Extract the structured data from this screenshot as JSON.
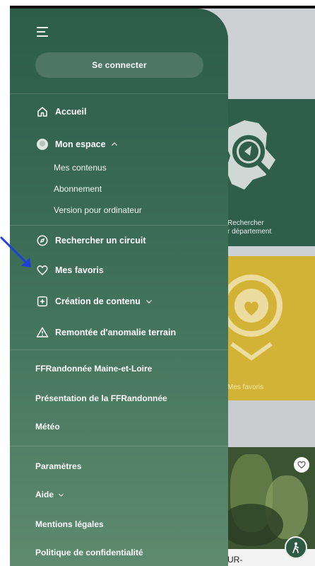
{
  "drawer": {
    "connect_label": "Se connecter",
    "items": {
      "home": "Accueil",
      "space": "Mon espace",
      "search": "Rechercher un circuit",
      "favorites": "Mes favoris",
      "create": "Création de contenu",
      "report": "Remontée d'anomalie terrain"
    },
    "space_sub": [
      "Mes contenus",
      "Abonnement",
      "Version pour ordinateur"
    ],
    "links": [
      "FFRandonnée Maine-et-Loire",
      "Présentation de la FFRandonnée",
      "Météo",
      "Paramètres",
      "Aide",
      "Mentions légales",
      "Politique de confidentialité"
    ]
  },
  "background": {
    "search_card_label_1": "Rechercher",
    "search_card_label_2": "r département",
    "fav_card_label": "Mes favoris",
    "bottom_text": "UR-"
  },
  "colors": {
    "drawer_top": "#2d5c4b",
    "drawer_bottom": "#5e8b6e",
    "search_card": "#2f5e4c",
    "fav_card": "#d3b336",
    "annotation_arrow": "#1f3fd8"
  },
  "icons": [
    "menu-icon",
    "home-icon",
    "avatar-icon",
    "chevron-up-icon",
    "compass-icon",
    "heart-icon",
    "plus-square-icon",
    "chevron-down-icon",
    "warning-icon",
    "hiker-icon"
  ]
}
